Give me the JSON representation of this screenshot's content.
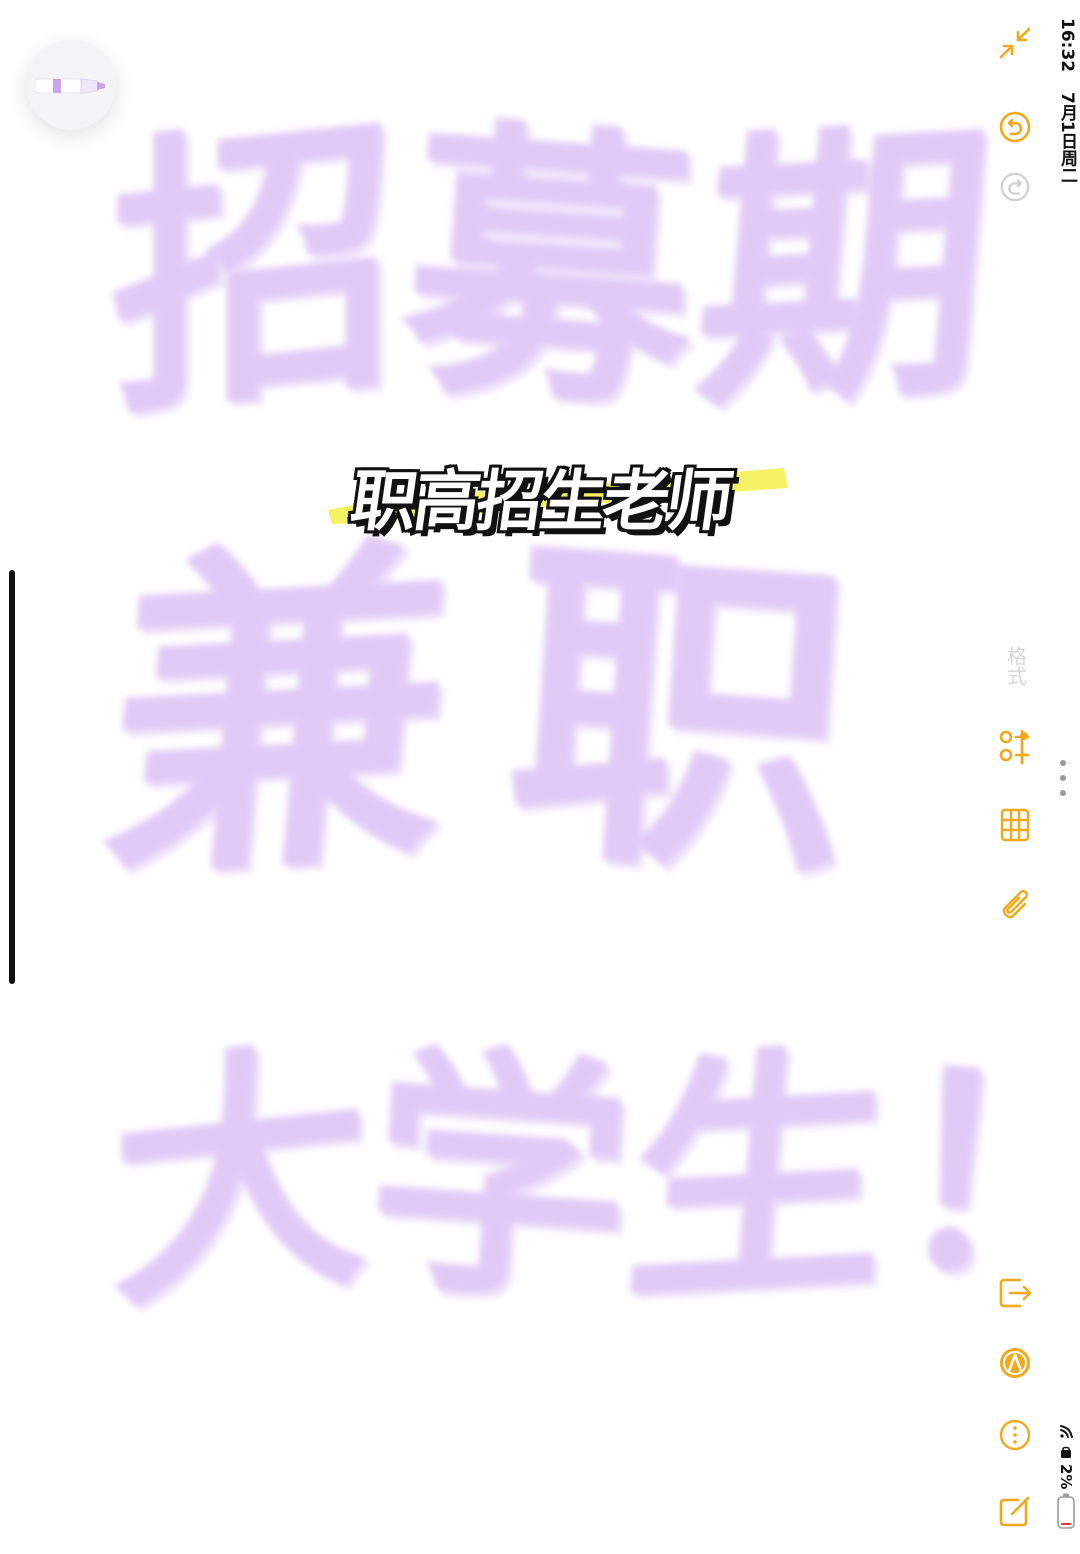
{
  "canvas": {
    "handwriting": {
      "line1": [
        "招",
        "募",
        "期"
      ],
      "line2": [
        "兼",
        "职"
      ],
      "line3": [
        "大",
        "学",
        "生",
        "！"
      ]
    },
    "ink_color": "#cfa9f2",
    "caption": {
      "text": "职高招生老师",
      "highlight_color": "#f3f04a"
    }
  },
  "toolbar": {
    "format_label": "格式",
    "accent_color": "#f0a81c",
    "icons": [
      "collapse-icon",
      "undo-icon",
      "redo-icon",
      "checklist-icon",
      "table-icon",
      "attachment-icon",
      "share-icon",
      "markup-icon",
      "more-icon",
      "compose-icon"
    ]
  },
  "status_bar": {
    "time": "16:32",
    "date": "7月1日周二",
    "battery": "2%",
    "battery_color": "#e53935"
  }
}
